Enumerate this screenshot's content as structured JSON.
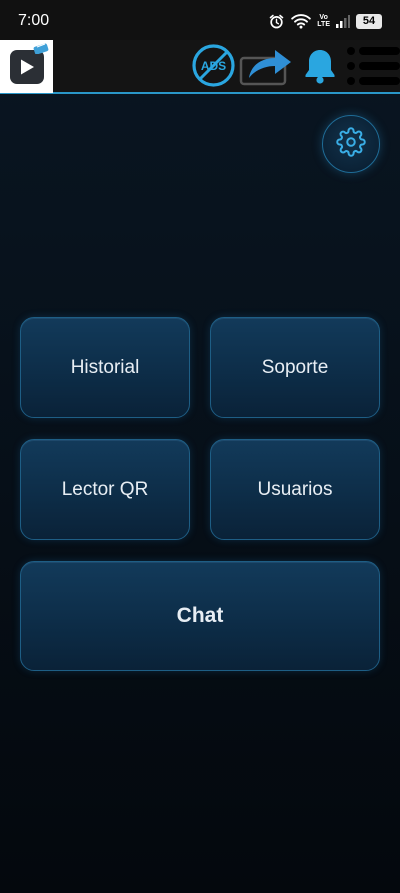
{
  "status_bar": {
    "time": "7:00",
    "volte_top": "Vo",
    "volte_bottom": "LTE",
    "battery": "54",
    "icons": [
      "alarm-icon",
      "wifi-icon",
      "volte-icon",
      "signal-icon",
      "battery-icon"
    ]
  },
  "app_bar": {
    "icons": [
      "app-logo-icon",
      "no-ads-icon",
      "share-icon",
      "bell-icon",
      "menu-list-icon"
    ],
    "no_ads_label": "ADS"
  },
  "main": {
    "settings_icon": "gear-icon",
    "buttons": [
      {
        "label": "Historial"
      },
      {
        "label": "Soporte"
      },
      {
        "label": "Lector QR"
      },
      {
        "label": "Usuarios"
      },
      {
        "label": "Chat"
      }
    ]
  },
  "colors": {
    "accent": "#2a97c8",
    "button_bg": "#0d2d48",
    "button_border": "#1e5e85",
    "background": "#07111b"
  }
}
